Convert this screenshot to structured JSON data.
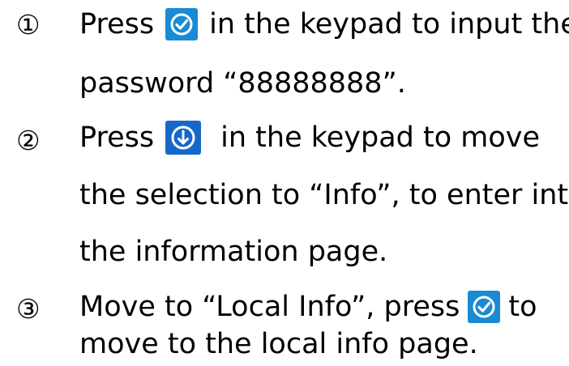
{
  "colors": {
    "confirm_key_bg": "#1a8ad3",
    "down_key_bg": "#1668c8",
    "icon_fg": "#ffffff"
  },
  "icons": {
    "confirm": "check-circle-icon",
    "down": "arrow-down-circle-icon"
  },
  "steps": [
    {
      "number": "①",
      "line1_before": "Press",
      "line1_after": "in the keypad to input the",
      "line2": "password “88888888”."
    },
    {
      "number": "②",
      "line1_before": "Press",
      "line1_after": "in the keypad to move",
      "line2": "the selection to “Info”, to enter into",
      "line3": "the information page."
    },
    {
      "number": "③",
      "line1_before": "Move to “Local Info”, press",
      "line1_after": "to",
      "line2": "move to the local info page."
    }
  ]
}
